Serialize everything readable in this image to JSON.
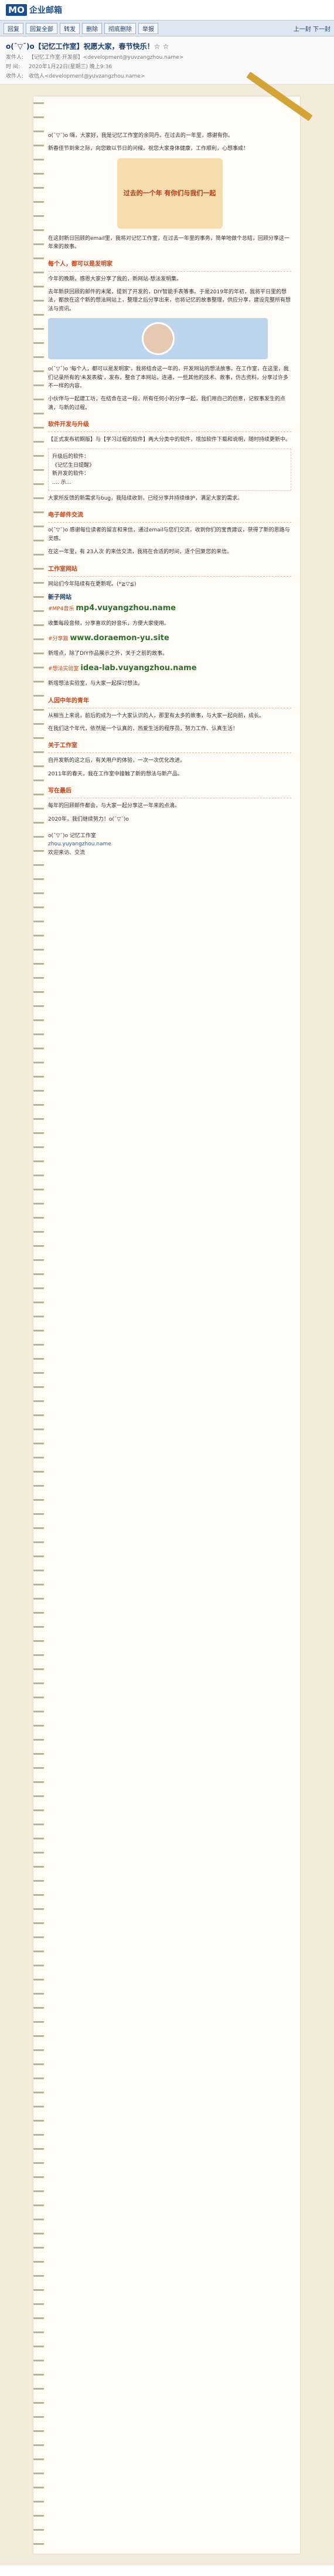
{
  "app": {
    "logo_mark": "MO",
    "logo_text": "企业邮箱"
  },
  "toolbar": {
    "buttons": [
      "回复",
      "回复全部",
      "转发",
      "删除",
      "彻底删除",
      "举报"
    ],
    "nav": "上一封  下一封"
  },
  "mail": {
    "subject": "o(ˉ▽ˉ)o【记忆工作室】祝愿大家，春节快乐！☆ ☆",
    "from_label": "发件人:",
    "from": "【记忆工作室·开发部】<development@yuvzangzhou.name>",
    "time_label": "时 间:",
    "time": "2020年1月22日(星期三) 晚上9:36",
    "to_label": "收件人:",
    "to": "收信人<development@yuvzangzhou.name>"
  },
  "body": {
    "intro": [
      "o(ˉ▽ˉ)o 嗨，大家好，我是记忆工作室的余同丹。在过去的一年里，感谢有你。",
      "新春佳节到来之际，向您致以节日的问候。祝您大家身体健康，工作顺利，心想事成！"
    ],
    "hero_text": "过去的一个年 有你们与我们一起",
    "recap": "在这封新日回顾的email里，我将对记忆工作室，在过去一年里的事务，简单地做个总结，回顾分享这一年来的故事。",
    "s1_title": "每个人，都可以是发明家",
    "s1_p1": "今年的晚期，感恩大家分享了我的，新网站-想法发明集。",
    "s1_p2": "去年新获回顾的邮件的末尾，提到了开发的，DIY智能手表等事。于是2019年的年初，我将平日里的想法，都放在这个新的想法网站上，整理之后分享出来，也将记忆的故事整理，供应分享，建设完整所有想法与资讯。",
    "s1_p3": "o(ˉ▽ˉ)o '每个人，都可以是发明家'，我将结合这一年的，开发网站的想法故事。在工作室，在这里，我们记录所有的'未发表稿'，发布，整合了本网站，连通，一些其他的技术、故事，仿古资料，分享过许多不一样的内容。",
    "s1_p4": "小伙伴与一起建工坊，在结合在这一段，所有任何小的分享一起，我们用自己的创意，记叙事发生的点滴，与新的过程。",
    "s2_title": "软件开发与升级",
    "s2_p1": "【正式发布初期版】与【学习过程的软件】两大分类中的软件，增加软件下载和说明，随时持续更新中。",
    "s2_box": [
      "升级后的软件：",
      "《记忆生日提醒》",
      "新开发的软件：",
      "…. 示…"
    ],
    "s2_p2": "大家所反馈的新需求与bug，我陆续收到，已经分享并持续维护，满足大家的需求。",
    "s3_title": "电子邮件交流",
    "s3_p1": "o(ˉ▽ˉ)o 感谢每位读者的留言和来信，通过email与您们交流，收到你们的宝贵建议，获得了新的思路与灵感。",
    "s3_p2": "在这一年里，有 23人次 的来信交流，我将在合适的时间，逐个回复您的来信。",
    "s4_title": "工作室网站",
    "s4_p1": "网站们今年陆续有在更新呢。(*≧▽≦)",
    "new_site_label": "新子网站",
    "sites": [
      {
        "tag": "#MP4音乐",
        "name": "mp4.vuyangzhou.name",
        "desc": "收集每段音频，分享喜欢的好音乐，方便大家使用。"
      },
      {
        "tag": "#分享篇",
        "name": "www.doraemon-yu.site",
        "desc": "新增点，除了DIY作品展示之外，关于之前的故事。"
      },
      {
        "tag": "#想法实验室",
        "name": "idea-lab.vuyangzhou.name",
        "desc": "新增想法实验室，与大家一起探讨想法。"
      }
    ],
    "s5_title": "人因中年的青年",
    "s5_p1": "从相当上来说，前后的成为一个大家认识的人，那里有太多的故事，与大家一起向前，成长。",
    "s5_p2": "在我们这个年代，依然是一个认真的，热爱生活的程序员，努力工作、认真生活！",
    "s6_title": "关于工作室",
    "s6_p1": "自开发新的这之后，有关用户的体验，一次一次优化改进。",
    "s6_p2": "2011年的春天，我在工作室中接触了新的想法与新产品。",
    "s7_title": "写在最后",
    "s7_p1": "每年的回顾邮件都会，与大家一起分享这一年来的点滴。",
    "s7_p2": "2020年，我们继续努力！o(ˉ▽ˉ)o",
    "sig": [
      "o(ˉ▽ˉ)o 记忆工作室",
      "zhou.yuyangzhou.name",
      "欢迎来访、交流"
    ]
  }
}
